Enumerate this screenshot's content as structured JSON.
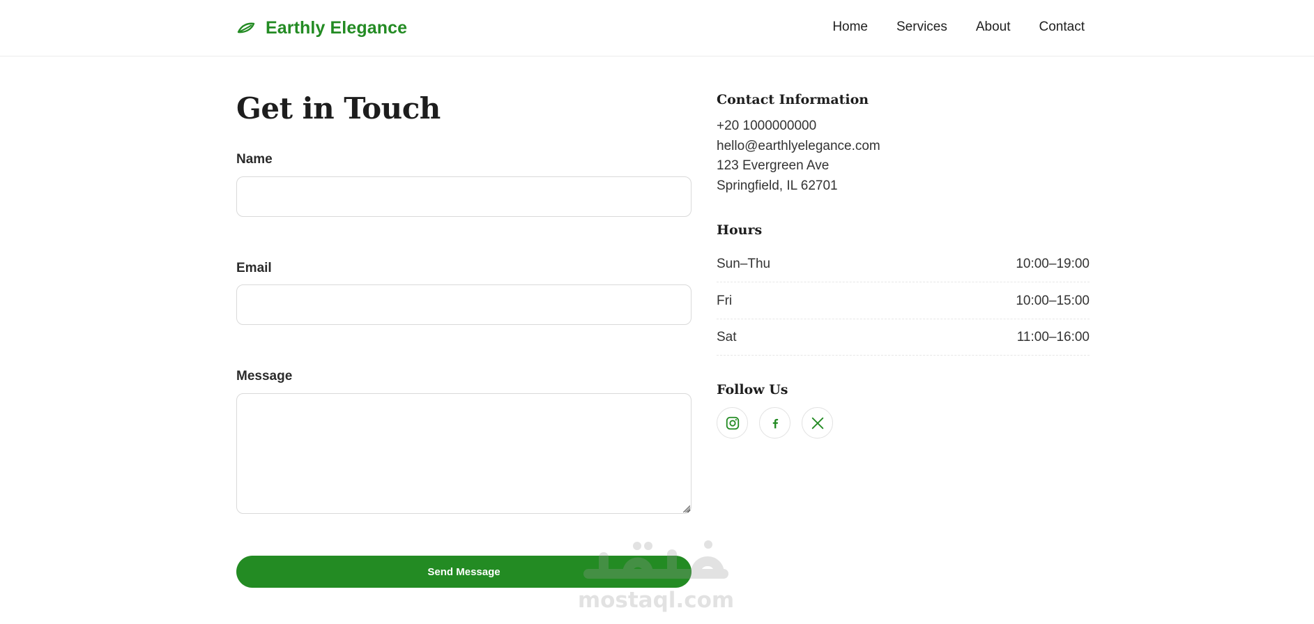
{
  "brand": {
    "name": "Earthly Elegance",
    "color": "#238b23"
  },
  "nav": {
    "items": [
      {
        "label": "Home"
      },
      {
        "label": "Services"
      },
      {
        "label": "About"
      },
      {
        "label": "Contact"
      }
    ]
  },
  "form": {
    "title": "Get in Touch",
    "name_label": "Name",
    "name_value": "",
    "email_label": "Email",
    "email_value": "",
    "message_label": "Message",
    "message_value": "",
    "submit_label": "Send Message"
  },
  "contact": {
    "heading": "Contact Information",
    "phone": "+20 1000000000",
    "email": "hello@earthlyelegance.com",
    "address_line1": "123 Evergreen Ave",
    "address_line2": "Springfield, IL 62701"
  },
  "hours": {
    "heading": "Hours",
    "rows": [
      {
        "day": "Sun–Thu",
        "time": "10:00–19:00"
      },
      {
        "day": "Fri",
        "time": "10:00–15:00"
      },
      {
        "day": "Sat",
        "time": "11:00–16:00"
      }
    ]
  },
  "social": {
    "heading": "Follow Us",
    "icons": [
      "instagram-icon",
      "facebook-icon",
      "x-icon"
    ]
  },
  "watermark": {
    "text": "mostaql.com"
  },
  "colors": {
    "accent": "#238b23",
    "text": "#1d1d1d",
    "border": "#d9d9d9"
  }
}
